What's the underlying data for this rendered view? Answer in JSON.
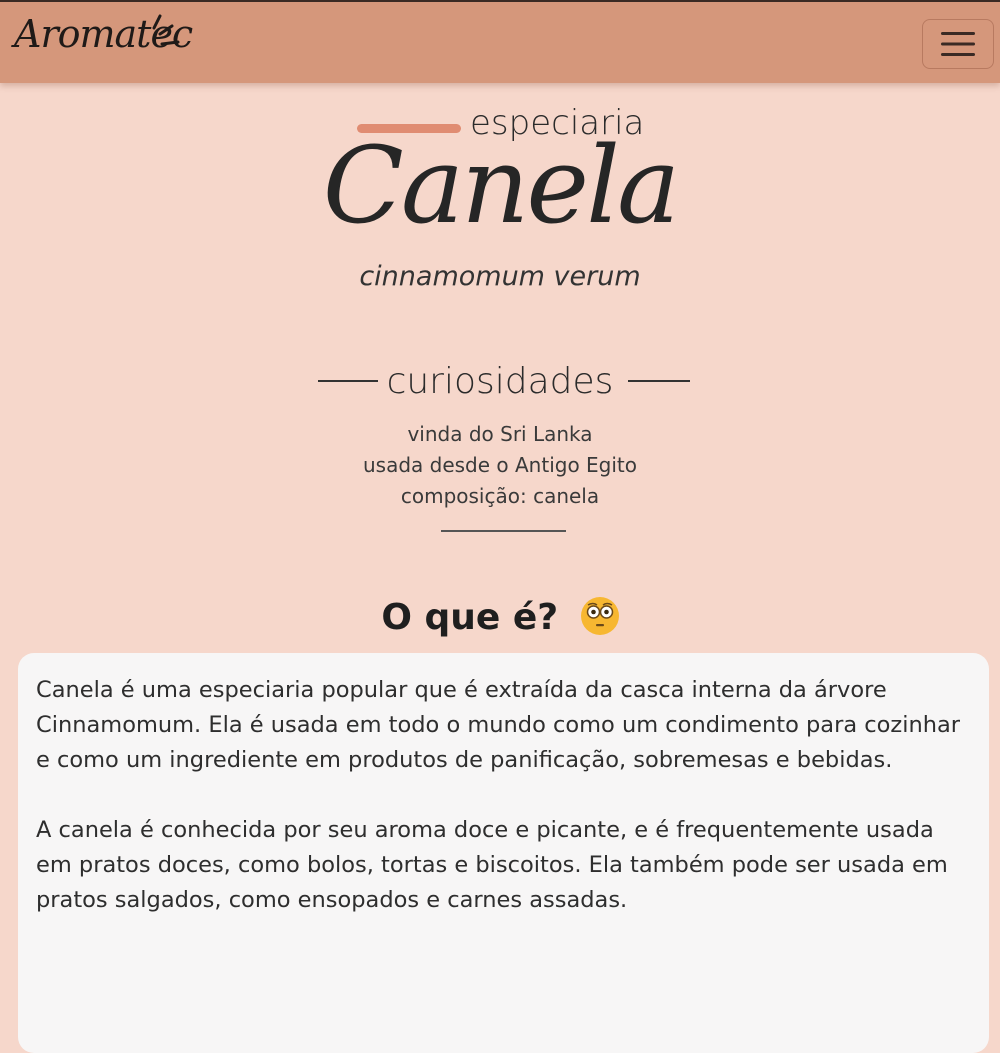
{
  "navbar": {
    "brand": "Aromatec",
    "menu_icon": "hamburger-icon"
  },
  "hero": {
    "kicker": "especiaria",
    "title": "Canela",
    "scientific_name": "cinnamomum verum"
  },
  "curiosities": {
    "title": "curiosidades",
    "facts": [
      "vinda do Sri Lanka",
      "usada desde o Antigo Egito",
      "composição: canela"
    ]
  },
  "section": {
    "title": "O que é?",
    "emoji": "flushed-face-icon"
  },
  "description": {
    "paragraphs": [
      "Canela é uma especiaria popular que é extraída da casca interna da árvore Cinnamomum. Ela é usada em todo o mundo como um condimento para cozinhar e como um ingrediente em produtos de panificação, sobremesas e bebidas.",
      "A canela é conhecida por seu aroma doce e picante, e é frequentemente usada em pratos doces, como bolos, tortas e biscoitos. Ela também pode ser usada em pratos salgados, como ensopados e carnes assadas."
    ]
  },
  "colors": {
    "navbar": "#d5977b",
    "page_background": "#f6d7cb",
    "accent": "#e08c72",
    "card": "#f7f6f6"
  }
}
